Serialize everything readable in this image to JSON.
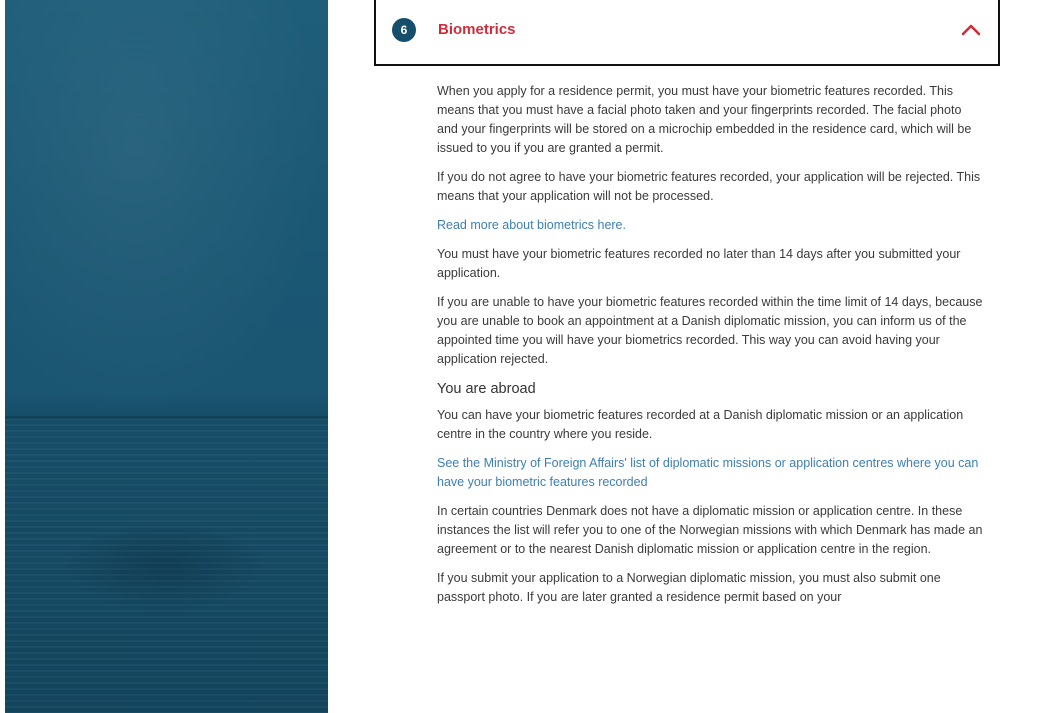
{
  "accordion": {
    "step_number": "6",
    "title": "Biometrics",
    "toggle_icon": "chevron-up-icon",
    "expanded": true,
    "title_color": "#d22b3a",
    "badge_color": "#164f6c"
  },
  "content": {
    "para1": "When you apply for a residence permit, you must have your biometric features recorded. This means that you must have a facial photo taken and your fingerprints recorded. The facial photo and your fingerprints will be stored on a microchip embedded in the residence card, which will be issued to you if you are granted a permit.",
    "para2": "If you do not agree to have your biometric features recorded, your application will be rejected. This means that your application will not be processed.",
    "link1": "Read more about biometrics here.",
    "para3": "You must have your biometric features recorded no later than 14 days after you submitted your application.",
    "para4": "If you are unable to have your biometric features recorded within the time limit of 14 days, because you are unable to book an appointment at a Danish diplomatic mission, you can inform us of the appointed time you will have your biometrics recorded. This way you can avoid having your application rejected.",
    "heading_abroad": "You are abroad",
    "para5": "You can have your biometric features recorded at a Danish diplomatic mission or an application centre in the country where you reside.",
    "link2": "See the Ministry of Foreign Affairs' list of diplomatic missions or application centres where you can have your biometric features recorded",
    "para6": "In certain countries Denmark does not have a diplomatic mission or application centre. In these instances the list will refer you to one of the Norwegian missions with which Denmark has made an agreement or to the nearest Danish diplomatic mission or application centre in the region.",
    "para7": "If you submit your application to a Norwegian diplomatic mission, you must also submit one passport photo. If you are later granted a residence permit based on your"
  },
  "colors": {
    "link": "#3d7fb6",
    "body_text": "#3a3a3a",
    "side_panel": "#1b5874"
  }
}
